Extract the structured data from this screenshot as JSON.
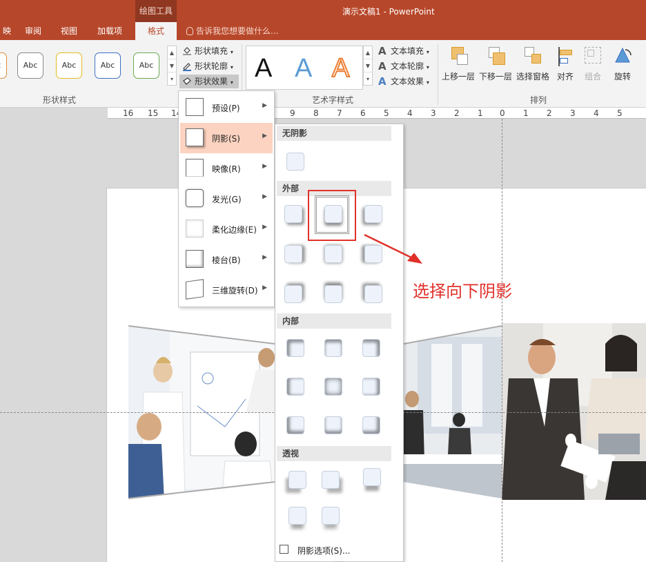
{
  "title_bar": {
    "context_group": "绘图工具",
    "document_title": "演示文稿1 - PowerPoint"
  },
  "tabs": [
    {
      "label": "映"
    },
    {
      "label": "审阅"
    },
    {
      "label": "视图"
    },
    {
      "label": "加载项"
    },
    {
      "label": "格式",
      "active": true
    }
  ],
  "tell_me": "告诉我您想要做什么...",
  "ribbon": {
    "shape_styles": {
      "label": "形状样式",
      "swatches": [
        {
          "text": "Abc",
          "border": "#e08a3a"
        },
        {
          "text": "Abc",
          "border": "#888888"
        },
        {
          "text": "Abc",
          "border": "#e3b91f"
        },
        {
          "text": "Abc",
          "border": "#3a6fbf"
        },
        {
          "text": "Abc",
          "border": "#6aa84f"
        }
      ],
      "scroll": [
        "▲",
        "▼",
        "▾"
      ]
    },
    "shape_format": {
      "fill": "形状填充",
      "outline": "形状轮廓",
      "effects": "形状效果"
    },
    "wordart": {
      "label": "艺术字样式",
      "samples": [
        {
          "char": "A",
          "color": "#111111"
        },
        {
          "char": "A",
          "color": "#5b9bd5"
        },
        {
          "char": "A",
          "color": "#ed7d31"
        }
      ],
      "text_fill": "文本填充",
      "text_outline": "文本轮廓",
      "text_effects": "文本效果"
    },
    "arrange": {
      "label": "排列",
      "bring_forward": "上移一层",
      "send_backward": "下移一层",
      "selection_pane": "选择窗格",
      "align": "对齐",
      "group": "组合",
      "rotate": "旋转"
    }
  },
  "ruler": {
    "labels": [
      "16",
      "15",
      "14",
      "9",
      "8",
      "7",
      "6",
      "5",
      "4",
      "3",
      "2",
      "1",
      "0",
      "1",
      "2",
      "3",
      "4",
      "5"
    ]
  },
  "effects_menu": {
    "items": [
      {
        "label": "预设(P)"
      },
      {
        "label": "阴影(S)",
        "active": true
      },
      {
        "label": "映像(R)"
      },
      {
        "label": "发光(G)"
      },
      {
        "label": "柔化边缘(E)"
      },
      {
        "label": "棱台(B)"
      },
      {
        "label": "三维旋转(D)"
      }
    ]
  },
  "shadow_menu": {
    "no_shadow": "无阴影",
    "outer": "外部",
    "inner": "内部",
    "perspective": "透视",
    "options": "阴影选项(S)..."
  },
  "annotation": {
    "text": "选择向下阴影",
    "color": "#e0302a"
  }
}
